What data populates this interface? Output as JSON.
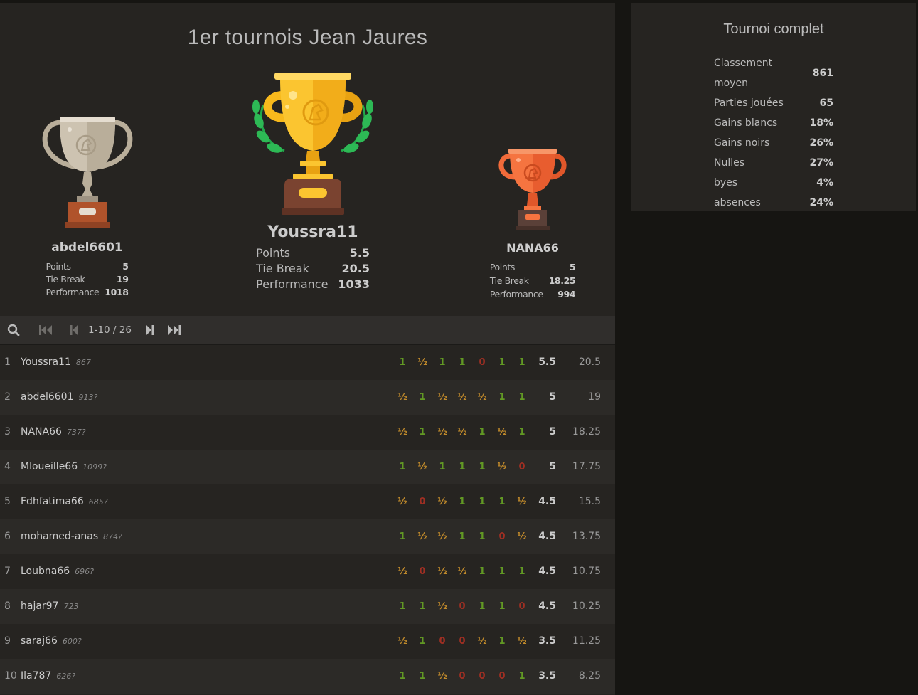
{
  "tournament": {
    "title": "1er tournois Jean Jaures"
  },
  "podium": {
    "first": {
      "name": "Youssra11",
      "stats": [
        {
          "k": "Points",
          "v": "5.5"
        },
        {
          "k": "Tie Break",
          "v": "20.5"
        },
        {
          "k": "Performance",
          "v": "1033"
        }
      ]
    },
    "second": {
      "name": "abdel6601",
      "stats": [
        {
          "k": "Points",
          "v": "5"
        },
        {
          "k": "Tie Break",
          "v": "19"
        },
        {
          "k": "Performance",
          "v": "1018"
        }
      ]
    },
    "third": {
      "name": "NANA66",
      "stats": [
        {
          "k": "Points",
          "v": "5"
        },
        {
          "k": "Tie Break",
          "v": "18.25"
        },
        {
          "k": "Performance",
          "v": "994"
        }
      ]
    }
  },
  "icons": {
    "search": "search-icon",
    "first": "first-page-icon",
    "prev": "prev-page-icon",
    "next": "next-page-icon",
    "last": "last-page-icon",
    "gold": "gold-trophy-icon",
    "silver": "silver-trophy-icon",
    "bronze": "bronze-trophy-icon"
  },
  "pager": {
    "info": "1-10 / 26"
  },
  "colors": {
    "win": "#629924",
    "draw": "#c28b2b",
    "loss": "#a02f23",
    "gold": "#f8b91c",
    "silver": "#cdc3b1",
    "bronze": "#f26b3a"
  },
  "standings": [
    {
      "rank": "1",
      "name": "Youssra11",
      "rating": "867",
      "results": [
        "1",
        "½",
        "1",
        "1",
        "0",
        "1",
        "1"
      ],
      "score": "5.5",
      "tb": "20.5"
    },
    {
      "rank": "2",
      "name": "abdel6601",
      "rating": "913?",
      "results": [
        "½",
        "1",
        "½",
        "½",
        "½",
        "1",
        "1"
      ],
      "score": "5",
      "tb": "19"
    },
    {
      "rank": "3",
      "name": "NANA66",
      "rating": "737?",
      "results": [
        "½",
        "1",
        "½",
        "½",
        "1",
        "½",
        "1"
      ],
      "score": "5",
      "tb": "18.25"
    },
    {
      "rank": "4",
      "name": "Mloueille66",
      "rating": "1099?",
      "results": [
        "1",
        "½",
        "1",
        "1",
        "1",
        "½",
        "0"
      ],
      "score": "5",
      "tb": "17.75"
    },
    {
      "rank": "5",
      "name": "Fdhfatima66",
      "rating": "685?",
      "results": [
        "½",
        "0",
        "½",
        "1",
        "1",
        "1",
        "½"
      ],
      "score": "4.5",
      "tb": "15.5"
    },
    {
      "rank": "6",
      "name": "mohamed-anas",
      "rating": "874?",
      "results": [
        "1",
        "½",
        "½",
        "1",
        "1",
        "0",
        "½"
      ],
      "score": "4.5",
      "tb": "13.75"
    },
    {
      "rank": "7",
      "name": "Loubna66",
      "rating": "696?",
      "results": [
        "½",
        "0",
        "½",
        "½",
        "1",
        "1",
        "1"
      ],
      "score": "4.5",
      "tb": "10.75"
    },
    {
      "rank": "8",
      "name": "hajar97",
      "rating": "723",
      "results": [
        "1",
        "1",
        "½",
        "0",
        "1",
        "1",
        "0"
      ],
      "score": "4.5",
      "tb": "10.25"
    },
    {
      "rank": "9",
      "name": "saraj66",
      "rating": "600?",
      "results": [
        "½",
        "1",
        "0",
        "0",
        "½",
        "1",
        "½"
      ],
      "score": "3.5",
      "tb": "11.25"
    },
    {
      "rank": "10",
      "name": "Ila787",
      "rating": "626?",
      "results": [
        "1",
        "1",
        "½",
        "0",
        "0",
        "0",
        "1"
      ],
      "score": "3.5",
      "tb": "8.25"
    }
  ],
  "summary": {
    "title": "Tournoi complet",
    "rows": [
      {
        "k": "Classement moyen",
        "v": "861"
      },
      {
        "k": "Parties jouées",
        "v": "65"
      },
      {
        "k": "Gains blancs",
        "v": "18%"
      },
      {
        "k": "Gains noirs",
        "v": "26%"
      },
      {
        "k": "Nulles",
        "v": "27%"
      },
      {
        "k": "byes",
        "v": "4%"
      },
      {
        "k": "absences",
        "v": "24%"
      }
    ]
  }
}
